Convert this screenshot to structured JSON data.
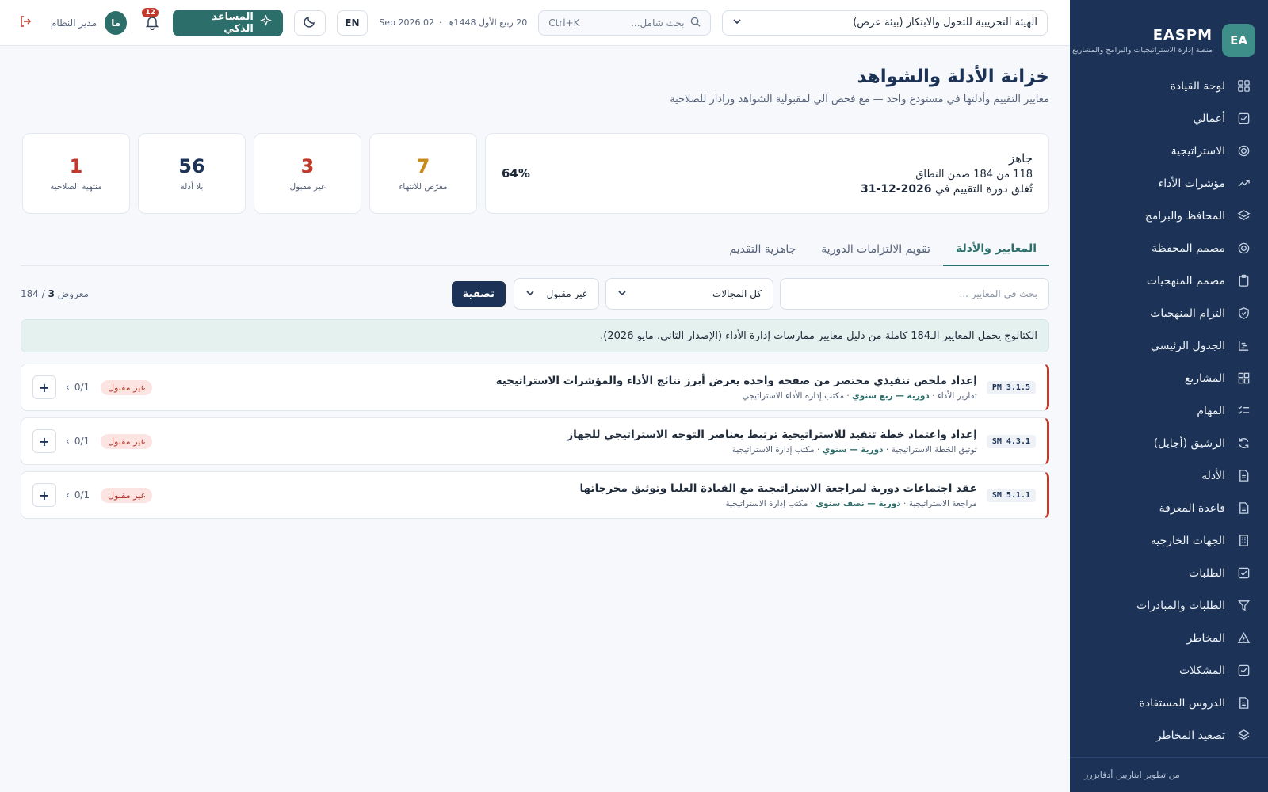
{
  "sidebar": {
    "logo_text": "EA",
    "brand_title": "EASPM",
    "brand_sub": "منصة إدارة الاستراتيجيات والبرامج والمشاريع",
    "items": [
      {
        "label": "لوحة القيادة",
        "icon": "dashboard-icon"
      },
      {
        "label": "أعمالي",
        "icon": "check-square-icon"
      },
      {
        "label": "الاستراتيجية",
        "icon": "target-icon"
      },
      {
        "label": "مؤشرات الأداء",
        "icon": "trend-up-icon"
      },
      {
        "label": "المحافظ والبرامج",
        "icon": "layers-icon"
      },
      {
        "label": "مصمم المحفظة",
        "icon": "target-icon"
      },
      {
        "label": "مصمم المنهجيات",
        "icon": "clipboard-icon"
      },
      {
        "label": "التزام المنهجيات",
        "icon": "shield-icon"
      },
      {
        "label": "الجدول الرئيسي",
        "icon": "gantt-icon"
      },
      {
        "label": "المشاريع",
        "icon": "grid-icon"
      },
      {
        "label": "المهام",
        "icon": "tasks-icon"
      },
      {
        "label": "الرشيق (أجايل)",
        "icon": "refresh-icon"
      },
      {
        "label": "الأدلة",
        "icon": "file-icon"
      },
      {
        "label": "قاعدة المعرفة",
        "icon": "file-icon"
      },
      {
        "label": "الجهات الخارجية",
        "icon": "building-icon"
      },
      {
        "label": "الطلبات",
        "icon": "check-square-icon"
      },
      {
        "label": "الطلبات والمبادرات",
        "icon": "filter-icon"
      },
      {
        "label": "المخاطر",
        "icon": "warning-icon"
      },
      {
        "label": "المشكلات",
        "icon": "check-square-icon"
      },
      {
        "label": "الدروس المستفادة",
        "icon": "file-icon"
      },
      {
        "label": "تصعيد المخاطر",
        "icon": "layers-icon"
      }
    ],
    "footer": "من تطوير ابتاريين أدفايزرز"
  },
  "topbar": {
    "org": "الهيئة التجريبية للتحول والابتكار (بيئة عرض)",
    "search_placeholder": "بحث شامل...",
    "search_shortcut": "Ctrl+K",
    "hijri_date": "20 ربيع الأول 1448هـ",
    "greg_date": "02 Sep 2026",
    "lang": "EN",
    "assistant_label": "المساعد الذكي",
    "notif_count": "12",
    "avatar_initials": "ما",
    "user_name": "مدير النظام"
  },
  "page": {
    "title": "خزانة الأدلة والشواهد",
    "subtitle": "معايير التقييم وأدلتها في مستودع واحد — مع فحص آلي لمقبولية الشواهد ورادار للصلاحية"
  },
  "readiness": {
    "label": "جاهز",
    "count_text": "118 من 184 ضمن النطاق",
    "deadline_prefix": "تُغلق دورة التقييم في",
    "deadline_date": "2026-12-31",
    "percent": "64%"
  },
  "stats": [
    {
      "value": "7",
      "label": "معرّض للانتهاء",
      "color": "#c98a1b"
    },
    {
      "value": "3",
      "label": "غير مقبول",
      "color": "#c0392b"
    },
    {
      "value": "56",
      "label": "بلا أدلة",
      "color": "#1c3357"
    },
    {
      "value": "1",
      "label": "منتهية الصلاحية",
      "color": "#c0392b"
    }
  ],
  "tabs": [
    {
      "label": "المعايير والأدلة",
      "active": true
    },
    {
      "label": "تقويم الالتزامات الدورية",
      "active": false
    },
    {
      "label": "جاهزية التقديم",
      "active": false
    }
  ],
  "filters": {
    "search_placeholder": "بحث في المعايير ...",
    "domain_value": "كل المجالات",
    "status_value": "غير مقبول",
    "apply_label": "تصفية",
    "shown_prefix": "معروض",
    "shown_count": "3",
    "shown_total": "/ 184"
  },
  "notice": "الكتالوج يحمل المعايير الـ184 كاملة من دليل معايير ممارسات إدارة الأداء (الإصدار الثاني، مايو 2026).",
  "criteria": [
    {
      "code": "PM 3.1.5",
      "title": "إعداد ملخص تنفيذي مختصر من صفحة واحدة يعرض أبرز نتائج الأداء والمؤشرات الاستراتيجية",
      "category": "تقارير الأداء",
      "frequency": "دورية — ربع سنوي",
      "owner": "مكتب إدارة الأداء الاستراتيجي",
      "status": "غير مقبول",
      "count": "0/1"
    },
    {
      "code": "SM 4.3.1",
      "title": "إعداد واعتماد خطة تنفيذ للاستراتيجية ترتبط بعناصر التوجه الاستراتيجي للجهاز",
      "category": "توثيق الخطة الاستراتيجية",
      "frequency": "دورية — سنوي",
      "owner": "مكتب إدارة الاستراتيجية",
      "status": "غير مقبول",
      "count": "0/1"
    },
    {
      "code": "SM 5.1.1",
      "title": "عقد اجتماعات دورية لمراجعة الاستراتيجية مع القيادة العليا وتوثيق مخرجاتها",
      "category": "مراجعة الاستراتيجية",
      "frequency": "دورية — نصف سنوي",
      "owner": "مكتب إدارة الاستراتيجية",
      "status": "غير مقبول",
      "count": "0/1"
    }
  ]
}
